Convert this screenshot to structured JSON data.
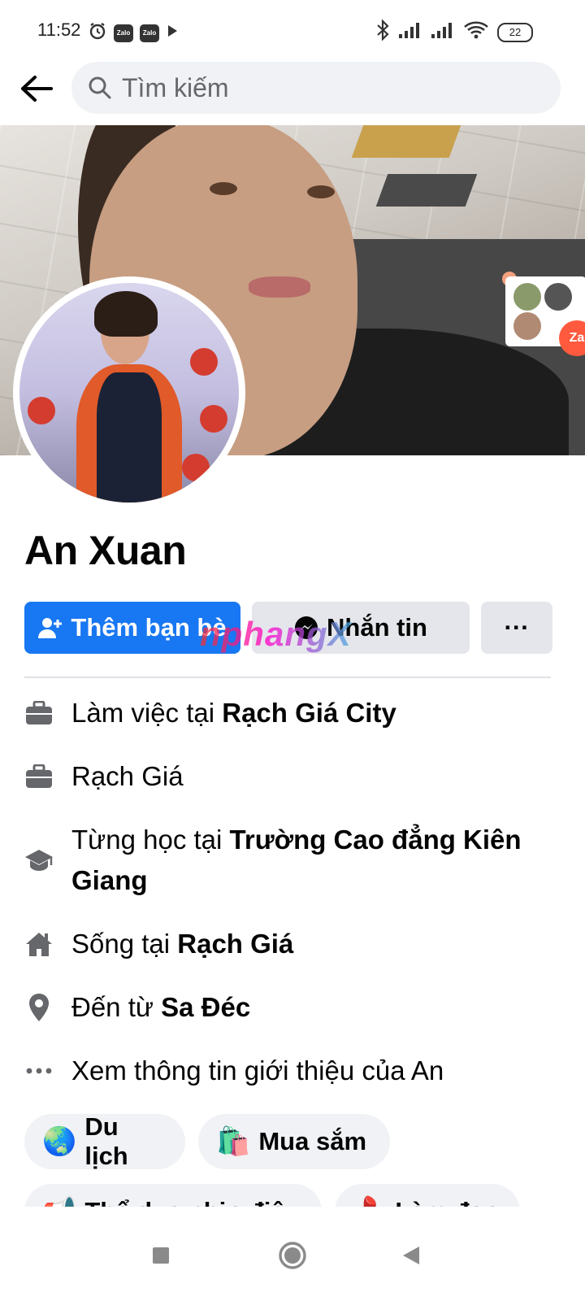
{
  "status_bar": {
    "time": "11:52",
    "zalo_label": "Zalo",
    "battery": "22",
    "icons": [
      "alarm-icon",
      "zalo-icon",
      "zalo-icon",
      "play-icon",
      "bluetooth-icon",
      "signal-icon",
      "signal-icon",
      "wifi-icon",
      "battery-icon"
    ]
  },
  "header": {
    "search_placeholder": "Tìm kiếm"
  },
  "cover": {
    "zalo_badge": "Za"
  },
  "profile": {
    "name": "An Xuan"
  },
  "actions": {
    "add_friend": "Thêm bạn bè",
    "message": "Nhắn tin",
    "more": "···"
  },
  "watermark": "nphangX",
  "details": [
    {
      "icon": "briefcase-icon",
      "prefix": "Làm việc tại ",
      "bold": "Rạch Giá City"
    },
    {
      "icon": "briefcase-icon",
      "prefix": "Rạch Giá",
      "bold": ""
    },
    {
      "icon": "graduation-cap-icon",
      "prefix": "Từng học tại ",
      "bold": "Trường Cao đẳng Kiên Giang"
    },
    {
      "icon": "home-icon",
      "prefix": "Sống tại ",
      "bold": "Rạch Giá"
    },
    {
      "icon": "location-pin-icon",
      "prefix": "Đến từ ",
      "bold": "Sa Đéc"
    },
    {
      "icon": "more-dots-icon",
      "prefix": "Xem thông tin giới thiệu của An",
      "bold": ""
    }
  ],
  "hobbies": [
    {
      "emoji": "🌏",
      "label": "Du lịch"
    },
    {
      "emoji": "🛍️",
      "label": "Mua sắm"
    },
    {
      "emoji": "📢",
      "label": "Thể dục nhịp điệu"
    },
    {
      "emoji": "💄",
      "label": "Làm đẹp"
    }
  ],
  "nav": [
    "recent-apps-button",
    "home-button",
    "back-button"
  ]
}
